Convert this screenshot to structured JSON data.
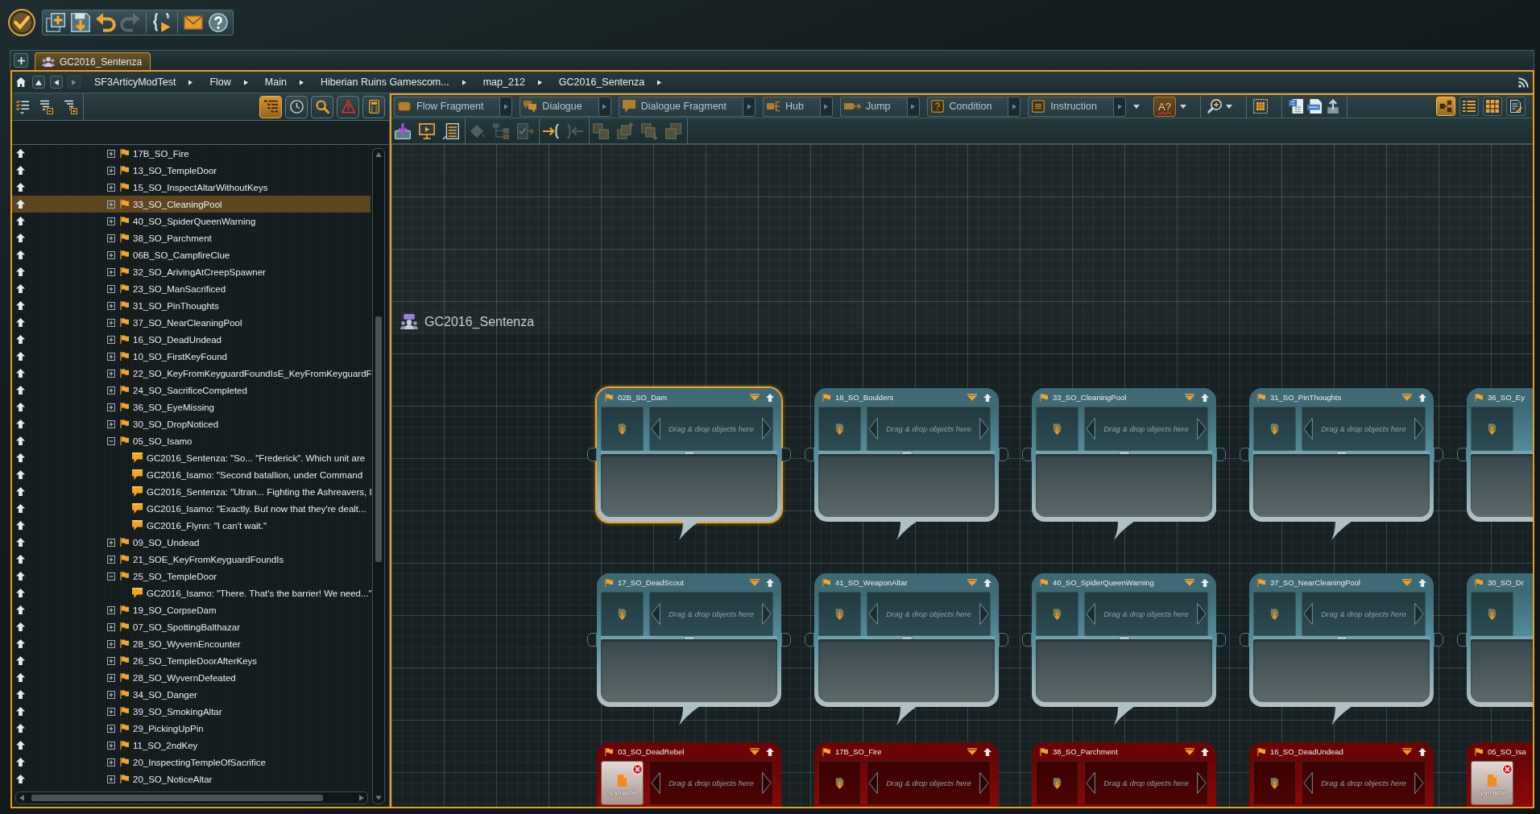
{
  "quick_access_toolbar": {
    "groups": [
      [
        {
          "kind": "new",
          "disabled": false
        },
        {
          "kind": "save",
          "disabled": false
        },
        {
          "kind": "undo",
          "disabled": false
        },
        {
          "kind": "redo",
          "disabled": true
        }
      ],
      [
        {
          "kind": "run_script",
          "disabled": false
        }
      ],
      [
        {
          "kind": "mail",
          "disabled": false
        },
        {
          "kind": "help",
          "disabled": false
        }
      ]
    ]
  },
  "document_tabs": [
    {
      "label": "GC2016_Sentenza",
      "selected": true
    }
  ],
  "breadcrumb": {
    "navigation": [
      {
        "kind": "up",
        "disabled": false
      },
      {
        "kind": "back",
        "disabled": false
      },
      {
        "kind": "forward",
        "disabled": true
      }
    ],
    "items": [
      "SF3ArticyModTest",
      "Flow",
      "Main",
      "Hiberian Ruins Gamescom...",
      "map_212",
      "GC2016_Sentenza"
    ]
  },
  "navigator": {
    "tabs": [
      {
        "kind": "tree",
        "selected": true
      },
      {
        "kind": "history",
        "selected": false
      },
      {
        "kind": "search",
        "selected": false
      },
      {
        "kind": "warnings",
        "selected": false
      },
      {
        "kind": "calculator",
        "selected": false
      }
    ],
    "tree": [
      {
        "kind": "fragment",
        "label": "17B_SO_Fire",
        "expanded": false,
        "selected": false
      },
      {
        "kind": "fragment",
        "label": "13_SO_TempleDoor",
        "expanded": false,
        "selected": false
      },
      {
        "kind": "fragment",
        "label": "15_SO_InspectAltarWithoutKeys",
        "expanded": false,
        "selected": false
      },
      {
        "kind": "fragment",
        "label": "33_SO_CleaningPool",
        "expanded": false,
        "selected": true
      },
      {
        "kind": "fragment",
        "label": "40_SO_SpiderQueenWarning",
        "expanded": false,
        "selected": false
      },
      {
        "kind": "fragment",
        "label": "38_SO_Parchment",
        "expanded": false,
        "selected": false
      },
      {
        "kind": "fragment",
        "label": "06B_SO_CampfireClue",
        "expanded": false,
        "selected": false
      },
      {
        "kind": "fragment",
        "label": "32_SO_ArivingAtCreepSpawner",
        "expanded": false,
        "selected": false
      },
      {
        "kind": "fragment",
        "label": "23_SO_ManSacrificed",
        "expanded": false,
        "selected": false
      },
      {
        "kind": "fragment",
        "label": "31_SO_PinThoughts",
        "expanded": false,
        "selected": false
      },
      {
        "kind": "fragment",
        "label": "37_SO_NearCleaningPool",
        "expanded": false,
        "selected": false
      },
      {
        "kind": "fragment",
        "label": "16_SO_DeadUndead",
        "expanded": false,
        "selected": false
      },
      {
        "kind": "fragment",
        "label": "10_SO_FirstKeyFound",
        "expanded": false,
        "selected": false
      },
      {
        "kind": "fragment",
        "label": "22_SO_KeyFromKeyguardFoundIsE_KeyFromKeyguardF",
        "expanded": false,
        "selected": false
      },
      {
        "kind": "fragment",
        "label": "24_SO_SacrificeCompleted",
        "expanded": false,
        "selected": false
      },
      {
        "kind": "fragment",
        "label": "36_SO_EyeMissing",
        "expanded": false,
        "selected": false
      },
      {
        "kind": "fragment",
        "label": "30_SO_DropNoticed",
        "expanded": false,
        "selected": false
      },
      {
        "kind": "fragment",
        "label": "05_SO_Isamo",
        "expanded": true,
        "selected": false,
        "children": [
          {
            "kind": "dialogue_line",
            "label": "GC2016_Sentenza: \"So... \"Frederick\". Which unit are",
            "selected": false
          },
          {
            "kind": "dialogue_line",
            "label": "GC2016_Isamo: \"Second batallion, under Command",
            "selected": false
          },
          {
            "kind": "dialogue_line",
            "label": "GC2016_Sentenza: \"Utran... Fighting the Ashreavers, I",
            "selected": false
          },
          {
            "kind": "dialogue_line",
            "label": "GC2016_Isamo: \"Exactly. But now that they're dealt...",
            "selected": false
          },
          {
            "kind": "dialogue_line",
            "label": "GC2016_Flynn: \"I can't wait.\"",
            "selected": false
          }
        ]
      },
      {
        "kind": "fragment",
        "label": "09_SO_Undead",
        "expanded": false,
        "selected": false
      },
      {
        "kind": "fragment",
        "label": "21_SOE_KeyFromKeyguardFoundIs",
        "expanded": false,
        "selected": false
      },
      {
        "kind": "fragment",
        "label": "25_SO_TempleDoor",
        "expanded": true,
        "selected": false,
        "children": [
          {
            "kind": "dialogue_line",
            "label": "GC2016_Isamo: \"There. That's the barrier! We need...\"",
            "selected": false
          }
        ]
      },
      {
        "kind": "fragment",
        "label": "19_SO_CorpseDam",
        "expanded": false,
        "selected": false
      },
      {
        "kind": "fragment",
        "label": "07_SO_SpottingBalthazar",
        "expanded": false,
        "selected": false
      },
      {
        "kind": "fragment",
        "label": "28_SO_WyvernEncounter",
        "expanded": false,
        "selected": false
      },
      {
        "kind": "fragment",
        "label": "26_SO_TempleDoorAfterKeys",
        "expanded": false,
        "selected": false
      },
      {
        "kind": "fragment",
        "label": "28_SO_WyvernDefeated",
        "expanded": false,
        "selected": false
      },
      {
        "kind": "fragment",
        "label": "34_SO_Danger",
        "expanded": false,
        "selected": false
      },
      {
        "kind": "fragment",
        "label": "39_SO_SmokingAltar",
        "expanded": false,
        "selected": false
      },
      {
        "kind": "fragment",
        "label": "29_PickingUpPin",
        "expanded": false,
        "selected": false
      },
      {
        "kind": "fragment",
        "label": "11_SO_2ndKey",
        "expanded": false,
        "selected": false
      },
      {
        "kind": "fragment",
        "label": "20_InspectingTempleOfSacrifice",
        "expanded": false,
        "selected": false
      },
      {
        "kind": "fragment",
        "label": "20_SO_NoticeAltar",
        "expanded": false,
        "selected": false
      }
    ]
  },
  "flow_editor": {
    "tools": [
      {
        "kind": "flow_fragment",
        "label": "Flow Fragment"
      },
      {
        "kind": "dialogue",
        "label": "Dialogue"
      },
      {
        "kind": "dialogue_fragment",
        "label": "Dialogue Fragment"
      },
      {
        "kind": "hub",
        "label": "Hub"
      },
      {
        "kind": "jump",
        "label": "Jump"
      },
      {
        "kind": "condition",
        "label": "Condition"
      },
      {
        "kind": "instruction",
        "label": "Instruction"
      }
    ],
    "spell_check": {
      "label": "A?"
    },
    "view_modes": [
      {
        "kind": "flow",
        "selected": true
      },
      {
        "kind": "list",
        "selected": false
      },
      {
        "kind": "tiles",
        "selected": false
      },
      {
        "kind": "properties",
        "selected": false
      }
    ],
    "secondary_tools": [
      [
        {
          "kind": "import",
          "disabled": false
        },
        {
          "kind": "presentation",
          "disabled": false
        },
        {
          "kind": "sheet",
          "disabled": false
        }
      ],
      [
        {
          "kind": "fill",
          "disabled": true
        },
        {
          "kind": "hierarchy",
          "disabled": true
        },
        {
          "kind": "approve",
          "disabled": true
        }
      ],
      [
        {
          "kind": "link_in",
          "disabled": false
        },
        {
          "kind": "link_out",
          "disabled": true
        }
      ],
      [
        {
          "kind": "stack",
          "disabled": true
        },
        {
          "kind": "stack_up",
          "disabled": true
        },
        {
          "kind": "stack_down",
          "disabled": true
        },
        {
          "kind": "stack_back",
          "disabled": true
        }
      ]
    ],
    "canvas": {
      "title": "GC2016_Sentenza",
      "node_rows": [
        {
          "nodes": [
            {
              "title": "02B_SO_Dam",
              "color": "#3e6a75",
              "selected": true,
              "drop_hint": "Drag & drop objects here"
            },
            {
              "title": "18_SO_Boulders",
              "color": "#3e6a75",
              "selected": false,
              "drop_hint": "Drag & drop objects here"
            },
            {
              "title": "33_SO_CleaningPool",
              "color": "#3e6a75",
              "selected": false,
              "drop_hint": "Drag & drop objects here"
            },
            {
              "title": "31_SO_PinThoughts",
              "color": "#3e6a75",
              "selected": false,
              "drop_hint": "Drag & drop objects here"
            },
            {
              "title": "36_SO_Ey",
              "color": "#3e6a75",
              "selected": false
            }
          ]
        },
        {
          "nodes": [
            {
              "title": "17_SO_DeadScout",
              "color": "#3e6a75",
              "selected": false,
              "drop_hint": "Drag & drop objects here"
            },
            {
              "title": "41_SO_WeaponAltar",
              "color": "#3e6a75",
              "selected": false,
              "drop_hint": "Drag & drop objects here"
            },
            {
              "title": "40_SO_SpiderQueenWarning",
              "color": "#3e6a75",
              "selected": false,
              "drop_hint": "Drag & drop objects here"
            },
            {
              "title": "37_SO_NearCleaningPool",
              "color": "#3e6a75",
              "selected": false,
              "drop_hint": "Drag & drop objects here"
            },
            {
              "title": "30_SO_Dr",
              "color": "#3e6a75",
              "selected": false
            }
          ]
        },
        {
          "nodes": [
            {
              "title": "03_SO_DeadRebel",
              "color": "#6a0505",
              "selected": false,
              "attachment": {
                "label": "Spymaster"
              },
              "drop_hint": "Drag & drop objects here"
            },
            {
              "title": "17B_SO_Fire",
              "color": "#6a0505",
              "selected": false,
              "drop_hint": "Drag & drop objects here"
            },
            {
              "title": "38_SO_Parchment",
              "color": "#6a0505",
              "selected": false,
              "drop_hint": "Drag & drop objects here"
            },
            {
              "title": "16_SO_DeadUndead",
              "color": "#6a0505",
              "selected": false,
              "drop_hint": "Drag & drop objects here"
            },
            {
              "title": "05_SO_Isa",
              "color": "#6a0505",
              "selected": false,
              "attachment": {
                "label": "Spymaster"
              }
            }
          ]
        }
      ]
    }
  }
}
